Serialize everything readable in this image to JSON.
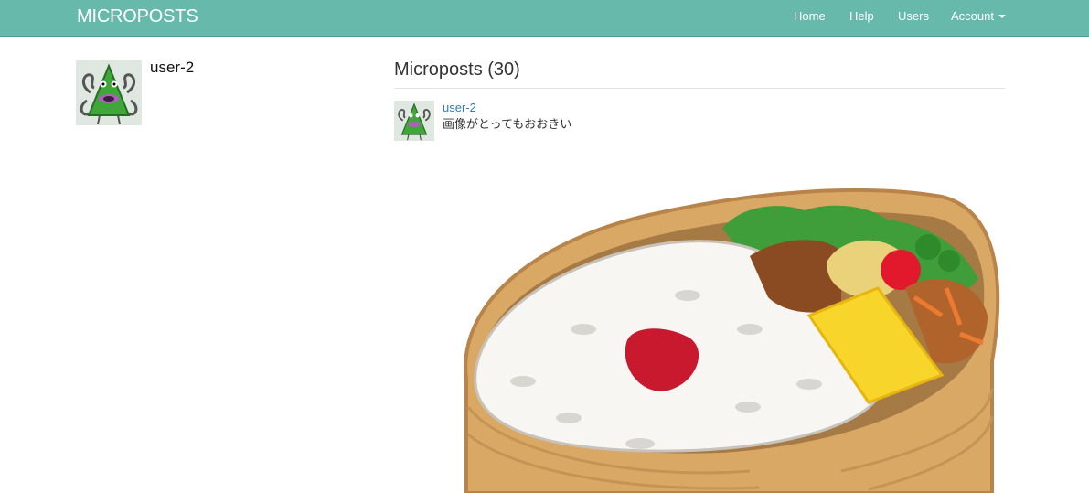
{
  "navbar": {
    "brand": "MICROPOSTS",
    "links": {
      "home": "Home",
      "help": "Help",
      "users": "Users",
      "account": "Account"
    },
    "color": "#66b9ab"
  },
  "profile": {
    "name": "user-2",
    "avatar_icon": "green-monster-avatar-icon"
  },
  "microposts": {
    "title": "Microposts (30)",
    "items": [
      {
        "user": "user-2",
        "content": "画像がとってもおおきい",
        "image_icon": "bento-box-image"
      }
    ]
  },
  "link_color": "#337ab7"
}
